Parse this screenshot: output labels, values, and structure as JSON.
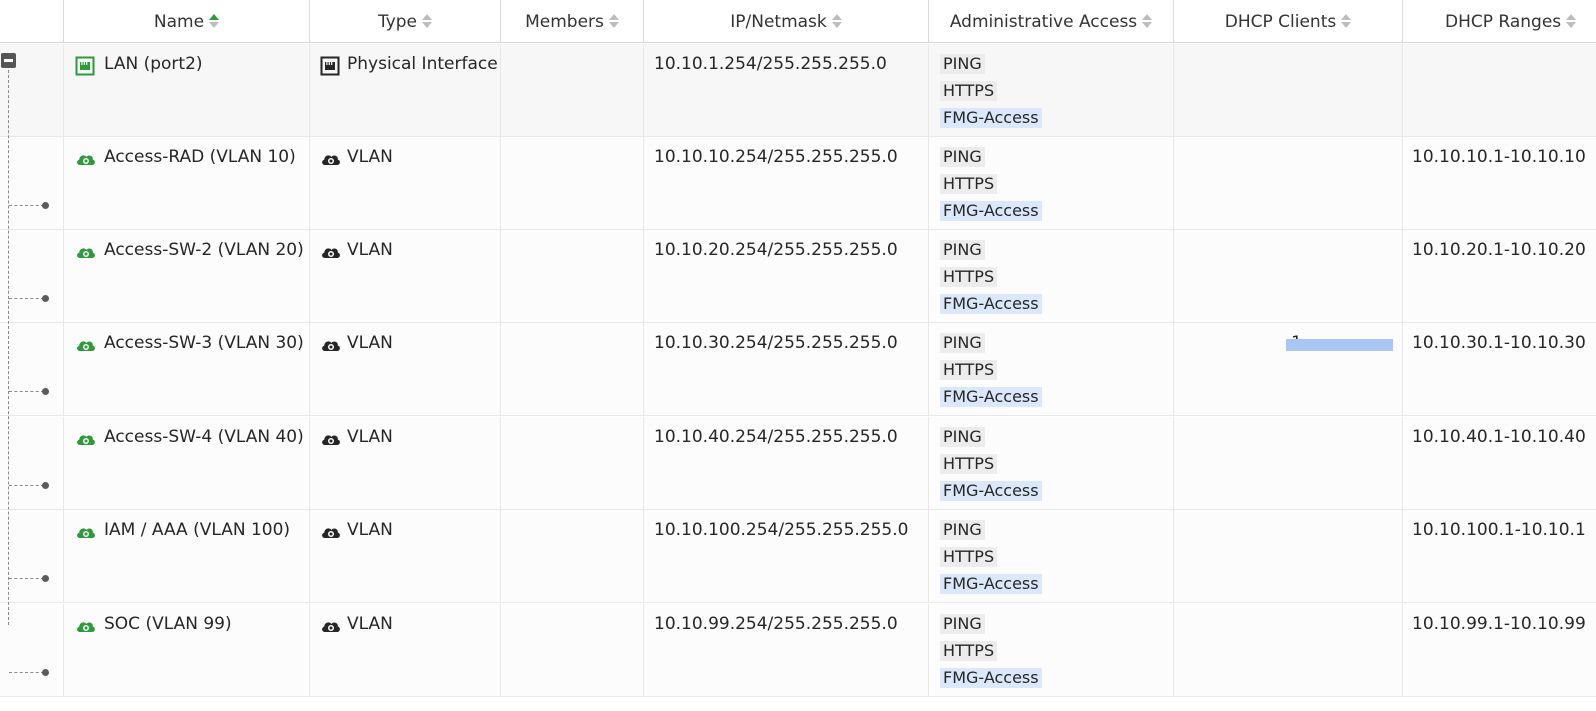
{
  "columns": {
    "name": "Name",
    "type": "Type",
    "members": "Members",
    "ip": "IP/Netmask",
    "access": "Administrative Access",
    "dhcp_clients": "DHCP Clients",
    "dhcp_ranges": "DHCP Ranges"
  },
  "sort": {
    "column": "name",
    "direction": "ascending"
  },
  "colors": {
    "active_sort": "#2e9b3a",
    "interface_icon": "#2e9b3a",
    "dhcp_bar": "#a9c6f5",
    "fmg_tag_bg": "#dbe8fb"
  },
  "rows": [
    {
      "name": "LAN (port2)",
      "name_icon": "physical-port-icon",
      "type": "Physical Interface",
      "type_icon": "physical-port-icon",
      "members": "",
      "ip": "10.10.1.254/255.255.255.0",
      "access": [
        "PING",
        "HTTPS",
        "FMG-Access"
      ],
      "dhcp_clients": "",
      "dhcp_range": "",
      "expanded": true
    },
    {
      "name": "Access-RAD (VLAN 10)",
      "name_icon": "vlan-cloud-icon",
      "type": "VLAN",
      "type_icon": "vlan-cloud-icon",
      "members": "",
      "ip": "10.10.10.254/255.255.255.0",
      "access": [
        "PING",
        "HTTPS",
        "FMG-Access"
      ],
      "dhcp_clients": "",
      "dhcp_range": "10.10.10.1-10.10.10"
    },
    {
      "name": "Access-SW-2 (VLAN 20)",
      "name_icon": "vlan-cloud-icon",
      "type": "VLAN",
      "type_icon": "vlan-cloud-icon",
      "members": "",
      "ip": "10.10.20.254/255.255.255.0",
      "access": [
        "PING",
        "HTTPS",
        "FMG-Access"
      ],
      "dhcp_clients": "",
      "dhcp_range": "10.10.20.1-10.10.20"
    },
    {
      "name": "Access-SW-3 (VLAN 30)",
      "name_icon": "vlan-cloud-icon",
      "type": "VLAN",
      "type_icon": "vlan-cloud-icon",
      "members": "",
      "ip": "10.10.30.254/255.255.255.0",
      "access": [
        "PING",
        "HTTPS",
        "FMG-Access"
      ],
      "dhcp_clients": "1",
      "dhcp_range": "10.10.30.1-10.10.30"
    },
    {
      "name": "Access-SW-4 (VLAN 40)",
      "name_icon": "vlan-cloud-icon",
      "type": "VLAN",
      "type_icon": "vlan-cloud-icon",
      "members": "",
      "ip": "10.10.40.254/255.255.255.0",
      "access": [
        "PING",
        "HTTPS",
        "FMG-Access"
      ],
      "dhcp_clients": "",
      "dhcp_range": "10.10.40.1-10.10.40"
    },
    {
      "name": "IAM / AAA (VLAN 100)",
      "name_icon": "vlan-cloud-icon",
      "type": "VLAN",
      "type_icon": "vlan-cloud-icon",
      "members": "",
      "ip": "10.10.100.254/255.255.255.0",
      "access": [
        "PING",
        "HTTPS",
        "FMG-Access"
      ],
      "dhcp_clients": "",
      "dhcp_range": "10.10.100.1-10.10.1"
    },
    {
      "name": "SOC (VLAN 99)",
      "name_icon": "vlan-cloud-icon",
      "type": "VLAN",
      "type_icon": "vlan-cloud-icon",
      "members": "",
      "ip": "10.10.99.254/255.255.255.0",
      "access": [
        "PING",
        "HTTPS",
        "FMG-Access"
      ],
      "dhcp_clients": "",
      "dhcp_range": "10.10.99.1-10.10.99"
    }
  ]
}
